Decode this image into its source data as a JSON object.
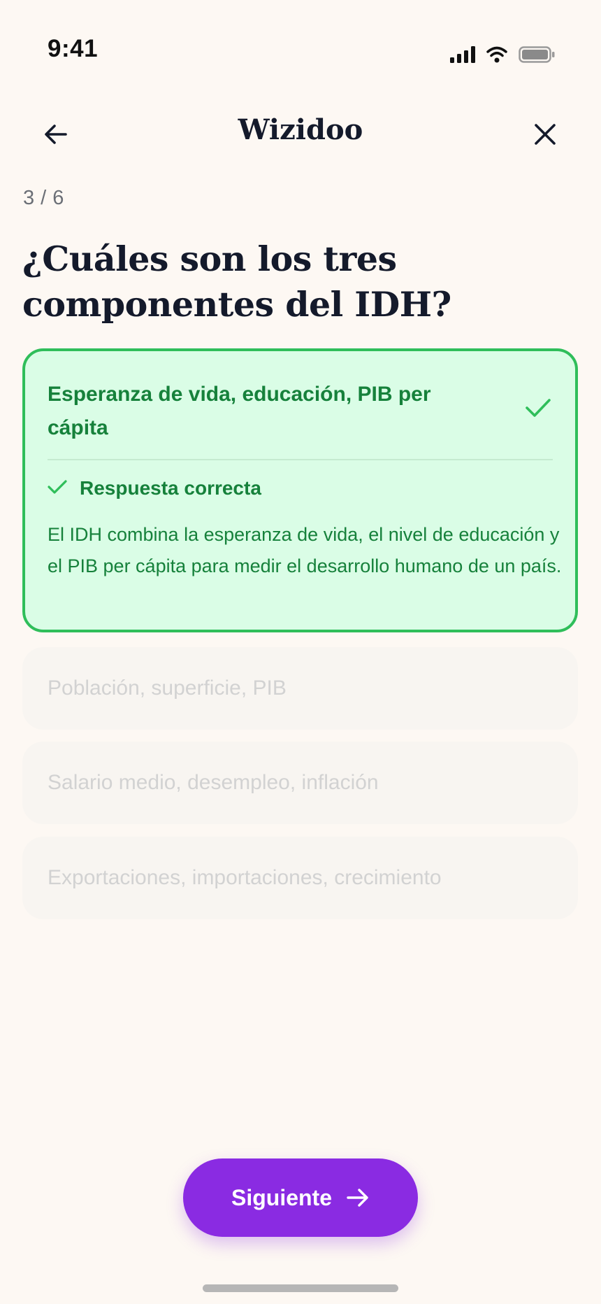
{
  "status_bar": {
    "time": "9:41",
    "icons": [
      "signal-icon",
      "wifi-icon",
      "battery-icon"
    ]
  },
  "header": {
    "title": "Wizidoo",
    "back_icon": "arrow-left-icon",
    "close_icon": "close-icon"
  },
  "progress": "3 / 6",
  "question": "¿Cuáles son los tres componentes del IDH?",
  "answer_options": [
    {
      "label": "Esperanza de vida, educación, PIB per cápita",
      "state": "correct",
      "feedback_title": "Respuesta correcta",
      "explanation": "El IDH combina la esperanza de vida, el nivel de educación y el PIB per cápita para medir el desarrollo humano de un país."
    },
    {
      "label": "Población, superficie, PIB",
      "state": "disabled"
    },
    {
      "label": "Salario medio, desempleo, inflación",
      "state": "disabled"
    },
    {
      "label": "Exportaciones, importaciones, crecimiento",
      "state": "disabled"
    }
  ],
  "next_button": {
    "label": "Siguiente",
    "icon": "arrow-right-icon"
  },
  "colors": {
    "background": "#fdf8f3",
    "correct_border": "#2fbe5a",
    "correct_fill": "#dafde6",
    "correct_text": "#16813b",
    "accent": "#8a2be2",
    "disabled_text": "#d2d2d2"
  }
}
